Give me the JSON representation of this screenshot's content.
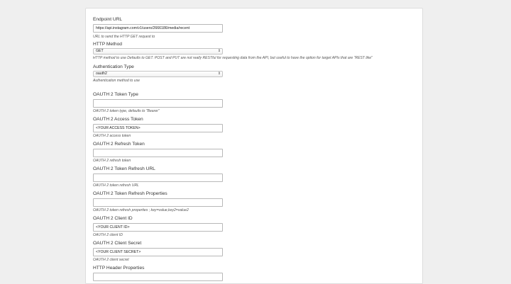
{
  "fields": [
    {
      "label": "Endpoint URL",
      "value": "https://api.instagram.com/v1/users/2666186/media/recent",
      "placeholder": "",
      "help": "URL to send the HTTP GET request to"
    },
    {
      "label": "HTTP Method",
      "value": "GET",
      "help": "HTTP method to use Defaults to GET. POST and PUT are not really RESTful for requesting data from the API, but useful to have the option for target APIs that are \"REST like\""
    },
    {
      "label": "Authentication Type",
      "value": "oauth2",
      "help": "Authentication method to use"
    },
    {
      "label": "OAUTH 2 Token Type",
      "value": "",
      "help": "OAUTH 2 token type, defaults to \"Bearer\""
    },
    {
      "label": "OAUTH 2 Access Token",
      "value": "<YOUR ACCESS TOKEN>",
      "help": "OAUTH 2 access token"
    },
    {
      "label": "OAUTH 2 Refresh Token",
      "value": "",
      "help": "OAUTH 2 refresh token"
    },
    {
      "label": "OAUTH 2 Token Refresh URL",
      "value": "",
      "help": "OAUTH 2 token refresh URL"
    },
    {
      "label": "OAUTH 2 Token Refresh Properties",
      "value": "",
      "help": "OAUTH 2 token refresh properties ; key=value,key2=value2"
    },
    {
      "label": "OAUTH 2 Client ID",
      "value": "<YOUR CLIENT ID>",
      "help": "OAUTH 2 client ID"
    },
    {
      "label": "OAUTH 2 Client Secret",
      "value": "<YOUR CLIENT SECRET>",
      "help": "OAUTH 2 client secret"
    },
    {
      "label": "HTTP Header Properties",
      "value": "",
      "help": ""
    }
  ],
  "icons": {
    "select_chevron": "up-down-chevron-icon"
  }
}
